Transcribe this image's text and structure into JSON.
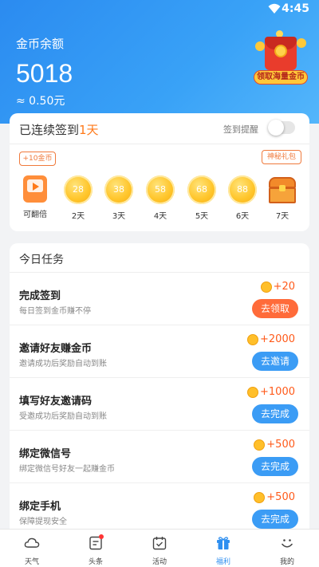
{
  "status_bar": {
    "time": "4:45"
  },
  "header": {
    "balance_label": "金币余额",
    "balance_value": "5018",
    "balance_rmb": "≈ 0.50元",
    "promo_button": "领取海量金币"
  },
  "signin": {
    "title_prefix": "已连续签到",
    "days_count": "1天",
    "remind_label": "签到提醒",
    "remind_on": false,
    "bubble_left": "+10金币",
    "bubble_right": "神秘礼包",
    "days": [
      {
        "label": "可翻倍",
        "coins": "",
        "icon": "video-icon"
      },
      {
        "label": "2天",
        "coins": "28"
      },
      {
        "label": "3天",
        "coins": "38"
      },
      {
        "label": "4天",
        "coins": "58"
      },
      {
        "label": "5天",
        "coins": "68"
      },
      {
        "label": "6天",
        "coins": "88"
      },
      {
        "label": "7天",
        "coins": "",
        "icon": "treasure-chest-icon"
      }
    ]
  },
  "tasks": {
    "title": "今日任务",
    "items": [
      {
        "name": "完成签到",
        "desc": "每日签到金币赚不停",
        "reward": "+20",
        "action": "去领取",
        "color": "#ff6b3a"
      },
      {
        "name": "邀请好友赚金币",
        "desc": "邀请成功后奖励自动到账",
        "reward": "+2000",
        "action": "去邀请",
        "color": "#3b9cf5"
      },
      {
        "name": "填写好友邀请码",
        "desc": "受邀成功后奖励自动到账",
        "reward": "+1000",
        "action": "去完成",
        "color": "#3b9cf5"
      },
      {
        "name": "绑定微信号",
        "desc": "绑定微信号好友一起赚金币",
        "reward": "+500",
        "action": "去完成",
        "color": "#3b9cf5"
      },
      {
        "name": "绑定手机",
        "desc": "保障提现安全",
        "reward": "+500",
        "action": "去完成",
        "color": "#3b9cf5"
      }
    ]
  },
  "tabbar": {
    "items": [
      {
        "label": "天气",
        "icon": "cloud-icon"
      },
      {
        "label": "头条",
        "icon": "news-icon",
        "badge": true
      },
      {
        "label": "活动",
        "icon": "calendar-icon"
      },
      {
        "label": "福利",
        "icon": "gift-icon",
        "active": true
      },
      {
        "label": "我的",
        "icon": "smile-icon"
      }
    ]
  }
}
